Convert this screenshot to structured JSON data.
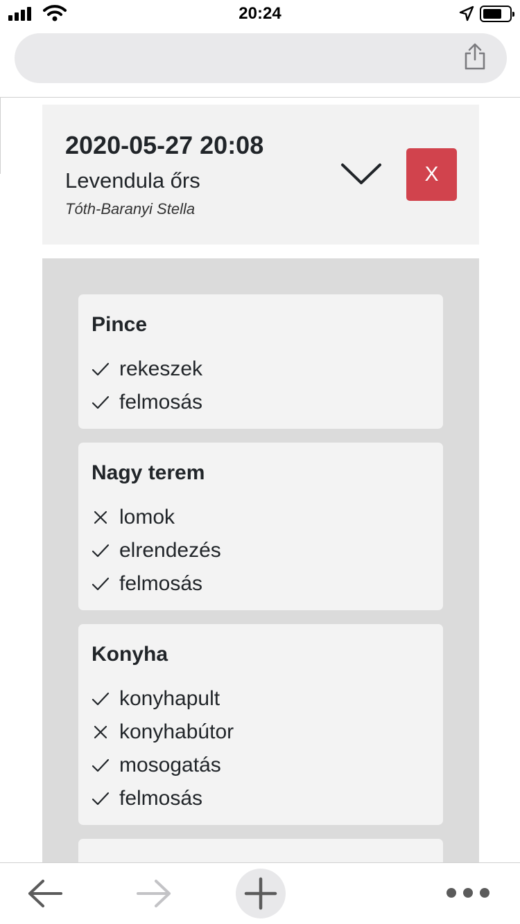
{
  "status_bar": {
    "time": "20:24"
  },
  "event": {
    "datetime": "2020-05-27 20:08",
    "place": "Levendula őrs",
    "person": "Tóth-Baranyi Stella",
    "close_label": "X"
  },
  "rooms": [
    {
      "title": "Pince",
      "tasks": [
        {
          "label": "rekeszek",
          "done": true
        },
        {
          "label": "felmosás",
          "done": true
        }
      ]
    },
    {
      "title": "Nagy terem",
      "tasks": [
        {
          "label": "lomok",
          "done": false
        },
        {
          "label": "elrendezés",
          "done": true
        },
        {
          "label": "felmosás",
          "done": true
        }
      ]
    },
    {
      "title": "Konyha",
      "tasks": [
        {
          "label": "konyhapult",
          "done": true
        },
        {
          "label": "konyhabútor",
          "done": false
        },
        {
          "label": "mosogatás",
          "done": true
        },
        {
          "label": "felmosás",
          "done": true
        }
      ]
    },
    {
      "title": "",
      "tasks": []
    }
  ],
  "icons": {
    "done": "check-icon",
    "not_done": "cross-icon",
    "share": "share-icon",
    "toggle": "chevron-down-icon",
    "back": "arrow-left-icon",
    "forward": "arrow-right-icon",
    "add": "plus-icon",
    "more": "more-dots-icon"
  },
  "colors": {
    "close_button": "#d1434d",
    "header_card": "#f2f2f2",
    "panel": "#dbdbdb",
    "room_card": "#f3f3f3"
  }
}
